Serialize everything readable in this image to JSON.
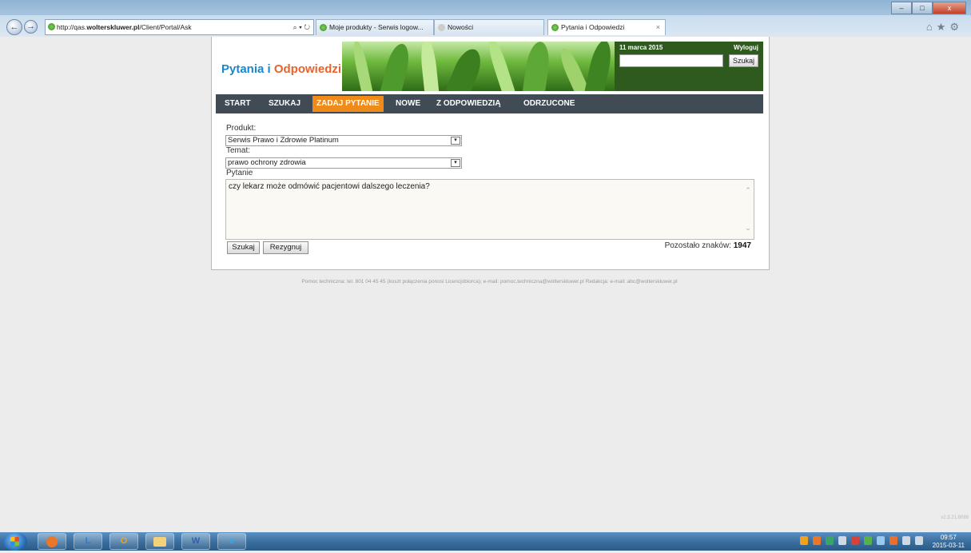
{
  "browser": {
    "url_prefix": "http://qas.",
    "url_domain": "wolterskluwer.pl",
    "url_path": "/Client/Portal/Ask",
    "addr_controls": "⌕ ▾ ↻",
    "tabs": [
      {
        "title": "Moje produkty - Serwis logow...",
        "active": false
      },
      {
        "title": "Nowości",
        "active": false
      },
      {
        "title": "Pytania i Odpowiedzi",
        "active": true
      }
    ],
    "tab_close": "×",
    "window_buttons": [
      "–",
      "□",
      "x"
    ],
    "toolbar_icons": "⌂★⚙",
    "back": "←",
    "forward": "→"
  },
  "header": {
    "logo_part1": "Pytania i ",
    "logo_part2": "Odpowiedzi",
    "date": "11 marca 2015",
    "logout": "Wyloguj",
    "search_value": "",
    "search_button": "Szukaj"
  },
  "nav": [
    {
      "label": "START",
      "active": false
    },
    {
      "label": "SZUKAJ",
      "active": false
    },
    {
      "label": "ZADAJ PYTANIE",
      "active": true
    },
    {
      "label": "NOWE",
      "active": false
    },
    {
      "label": "Z ODPOWIEDZIĄ",
      "active": false
    },
    {
      "label": "ODRZUCONE",
      "active": false
    }
  ],
  "form": {
    "product_label": "Produkt:",
    "product_value": "Serwis Prawo i Zdrowie Platinum",
    "topic_label": "Temat:",
    "topic_value": "prawo ochrony zdrowia",
    "question_label": "Pytanie",
    "question_value": "czy lekarz może odmówić pacjentowi dalszego leczenia?",
    "search_button": "Szukaj",
    "cancel_button": "Rezygnuj",
    "remaining_label": "Pozostało znaków: ",
    "remaining_count": "1947",
    "select_arrow": "▾",
    "scroll_up": "⌃",
    "scroll_down": "⌄"
  },
  "footer": {
    "text": "Pomoc techniczna: tel. 801 04 45 45 (koszt połączenia ponosi Licencjobiorca); e-mail: pomoc.techniczna@wolterskluwer.pl Redakcja: e-mail: abc@wolterskluwer.pl"
  },
  "version": "v2.3.21.6098",
  "taskbar": {
    "items": [
      {
        "icon": "firefox-icon",
        "glyph": "",
        "color": "#e8772a"
      },
      {
        "icon": "lync-icon",
        "glyph": "L",
        "color": "#2b7bd6"
      },
      {
        "icon": "outlook-icon",
        "glyph": "O",
        "color": "#f0a21c"
      },
      {
        "icon": "folder-icon",
        "glyph": "",
        "color": "#f3d27a"
      },
      {
        "icon": "word-icon",
        "glyph": "W",
        "color": "#2f5fae"
      },
      {
        "icon": "internet-explorer-icon",
        "glyph": "e",
        "color": "#3fa4e6"
      }
    ],
    "tray_colors": [
      "#f0a21c",
      "#e8772a",
      "#3aa56b",
      "#cfd8e3",
      "#d9413b",
      "#55b24a",
      "#9ac9ef",
      "#e86f2d",
      "#cfd8e3",
      "#cfd8e3"
    ],
    "time": "09:57",
    "date": "2015-03-11"
  }
}
